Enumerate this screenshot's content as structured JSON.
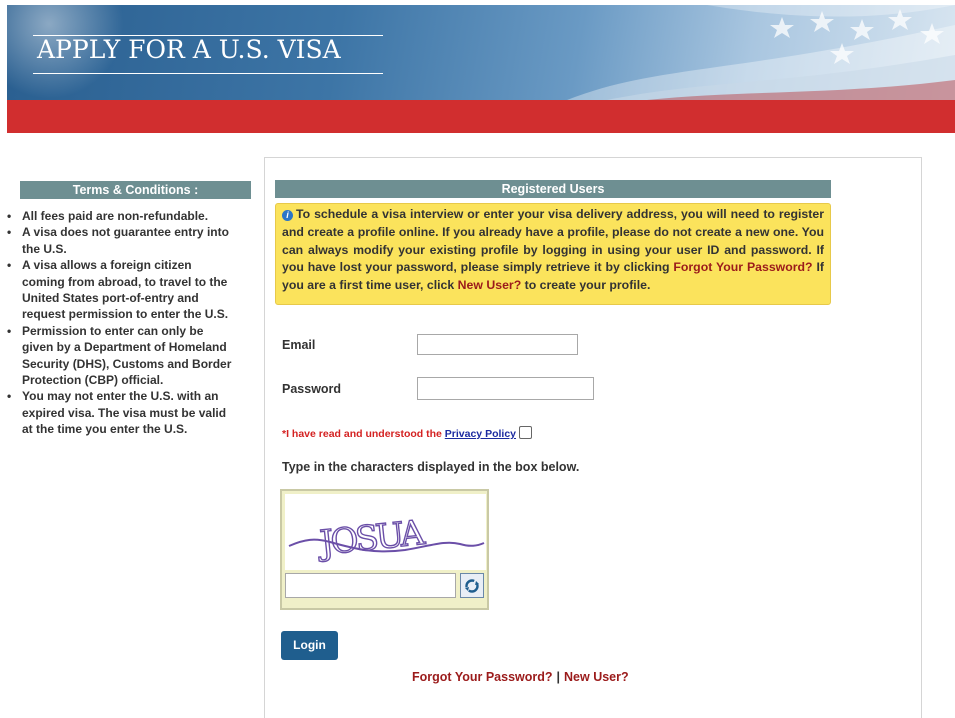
{
  "header": {
    "title": "APPLY FOR A U.S. VISA"
  },
  "sidebar": {
    "heading": "Terms & Conditions :",
    "terms": [
      "All fees paid are non-refundable.",
      "A visa does not guarantee entry into the U.S.",
      "A visa allows a foreign citizen coming from abroad, to travel to the United States port-of-entry and request permission to enter the U.S.",
      "Permission to enter can only be given by a Department of Homeland Security (DHS), Customs and Border Protection (CBP) official.",
      "You may not enter the U.S. with an expired visa. The visa must be valid at the time you enter the U.S."
    ]
  },
  "registered": {
    "heading": "Registered Users",
    "notice_part1": "To schedule a visa interview or enter your visa delivery address, you will need to register and create a profile online. If you already have a profile, please do not create a new one. You can always modify your existing profile by logging in using your user ID and password. If you have lost your password, please simply retrieve it by clicking ",
    "notice_link1": "Forgot Your Password?",
    "notice_part2": " If you are a first time user, click ",
    "notice_link2": "New User?",
    "notice_part3": " to create your profile."
  },
  "form": {
    "email_label": "Email",
    "email_value": "",
    "password_label": "Password",
    "password_value": "",
    "privacy_prefix": "*I have read and understood the ",
    "privacy_link": "Privacy Policy",
    "privacy_checked": false,
    "captcha_instruction": "Type in the characters displayed in the box below.",
    "captcha_text": "JOSUA",
    "captcha_value": "",
    "login_label": "Login"
  },
  "footer_links": {
    "forgot": "Forgot Your Password?",
    "separator": "|",
    "new_user": "New User?"
  },
  "colors": {
    "banner_blue": "#3d75a6",
    "red_bar": "#d12e2f",
    "section_header": "#6e8f92",
    "notice_bg": "#fbe35c",
    "link_red": "#9b1b1b",
    "login_button": "#1f5e8e",
    "privacy_red": "#d42222"
  },
  "icons": [
    "info-icon",
    "refresh-icon",
    "checkbox-icon"
  ]
}
